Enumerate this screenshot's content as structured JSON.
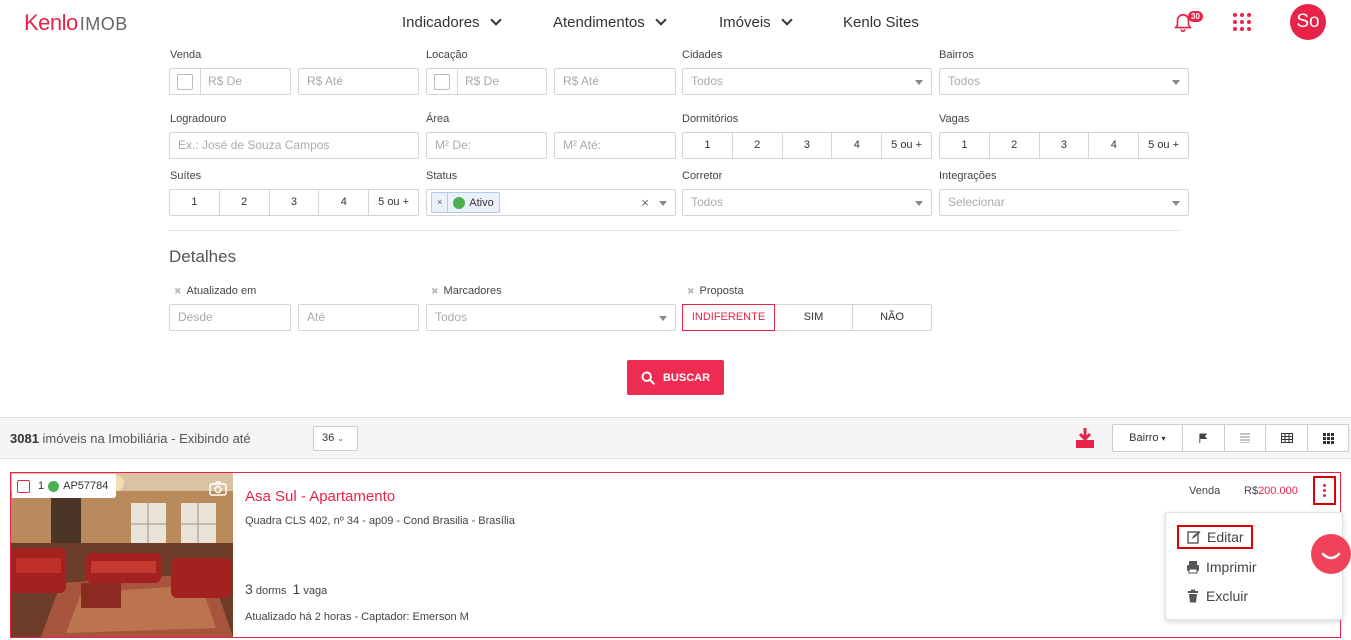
{
  "header": {
    "logo_main": "Kenlo",
    "logo_sub": "IMOB",
    "nav": [
      {
        "label": "Indicadores",
        "has_dropdown": true
      },
      {
        "label": "Atendimentos",
        "has_dropdown": true
      },
      {
        "label": "Imóveis",
        "has_dropdown": true
      },
      {
        "label": "Kenlo Sites",
        "has_dropdown": false
      }
    ],
    "notifications_count": "30",
    "avatar_initials": "So"
  },
  "filters": {
    "venda": {
      "label": "Venda",
      "from_placeholder": "R$ De",
      "to_placeholder": "R$ Até"
    },
    "locacao": {
      "label": "Locação",
      "from_placeholder": "R$ De",
      "to_placeholder": "R$ Até"
    },
    "cidades": {
      "label": "Cidades",
      "value": "Todos"
    },
    "bairros": {
      "label": "Bairros",
      "value": "Todos"
    },
    "logradouro": {
      "label": "Logradouro",
      "placeholder": "Ex.: José de Souza Campos"
    },
    "area": {
      "label": "Área",
      "from_placeholder": "M² De:",
      "to_placeholder": "M² Até:"
    },
    "dormitorios": {
      "label": "Dormitórios",
      "options": [
        "1",
        "2",
        "3",
        "4",
        "5 ou +"
      ]
    },
    "vagas": {
      "label": "Vagas",
      "options": [
        "1",
        "2",
        "3",
        "4",
        "5 ou +"
      ]
    },
    "suites": {
      "label": "Suítes",
      "options": [
        "1",
        "2",
        "3",
        "4",
        "5 ou +"
      ]
    },
    "status": {
      "label": "Status",
      "tag": "Ativo",
      "tag_remove": "×",
      "clear": "×"
    },
    "corretor": {
      "label": "Corretor",
      "value": "Todos"
    },
    "integracoes": {
      "label": "Integrações",
      "value": "Selecionar"
    }
  },
  "detalhes": {
    "heading": "Detalhes",
    "atualizado": {
      "label": "Atualizado em",
      "from_placeholder": "Desde",
      "to_placeholder": "Até"
    },
    "marcadores": {
      "label": "Marcadores",
      "value": "Todos"
    },
    "proposta": {
      "label": "Proposta",
      "options": [
        "INDIFERENTE",
        "SIM",
        "NÃO"
      ],
      "selected": "INDIFERENTE"
    }
  },
  "search_button": "BUSCAR",
  "listbar": {
    "count": "3081",
    "count_text": "imóveis na Imobiliária - Exibindo até",
    "per_page": "36",
    "sort_label": "Bairro"
  },
  "listing": {
    "index": "1",
    "code": "AP57784",
    "title": "Asa Sul - Apartamento",
    "address": "Quadra CLS 402, nº 34 - ap09 - Cond Brasilia - Brasília",
    "dorms_count": "3",
    "dorms_label": "dorms",
    "vagas_count": "1",
    "vagas_label": "vaga",
    "updated": "Atualizado há 2 horas - Captador: Emerson M",
    "deal_type": "Venda",
    "price_currency": "R$",
    "price_value": "200.000"
  },
  "context_menu": {
    "items": [
      {
        "label": "Editar",
        "icon": "edit-icon"
      },
      {
        "label": "Imprimir",
        "icon": "print-icon"
      },
      {
        "label": "Excluir",
        "icon": "trash-icon"
      }
    ]
  },
  "colors": {
    "accent": "#e8234a",
    "status_active": "#4caf50"
  }
}
